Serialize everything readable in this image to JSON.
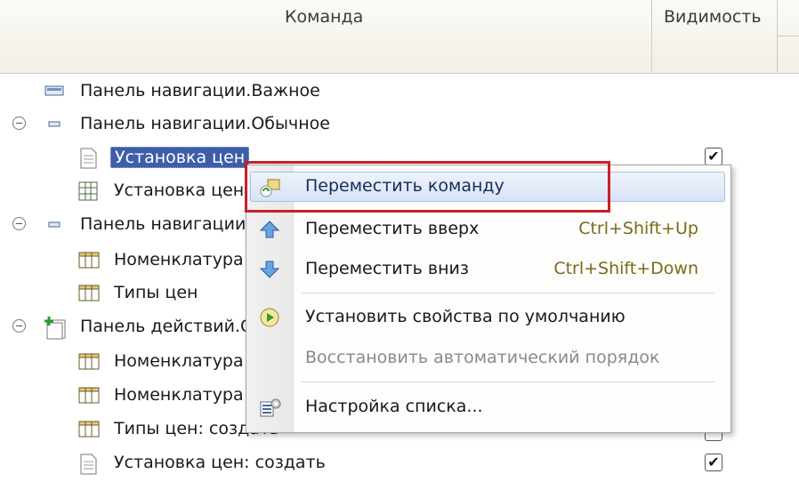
{
  "header": {
    "command_col": "Команда",
    "visibility_col": "Видимость"
  },
  "rows": [
    {
      "label": "Панель навигации.Важное",
      "icon": "panel-icon"
    },
    {
      "label": "Панель навигации.Обычное",
      "icon": "panel-small-icon"
    },
    {
      "label": "Установка цен",
      "icon": "document-icon",
      "checked": "✔"
    },
    {
      "label": "Установка цен",
      "icon": "table-grid-icon"
    },
    {
      "label": "Панель навигации",
      "icon": "panel-small-icon"
    },
    {
      "label": "Номенклатура",
      "icon": "table-icon"
    },
    {
      "label": "Типы цен",
      "icon": "table-icon"
    },
    {
      "label": "Панель действий.С",
      "icon": "action-panel-icon"
    },
    {
      "label": "Номенклатура",
      "icon": "table-icon"
    },
    {
      "label": "Номенклатура",
      "icon": "table-icon"
    },
    {
      "label": "Типы цен: создать",
      "icon": "table-icon"
    },
    {
      "label": "Установка цен: создать",
      "icon": "document-icon",
      "checked": "✔"
    }
  ],
  "context_menu": {
    "items": [
      {
        "label": "Переместить команду",
        "icon": "move-command-icon"
      },
      {
        "label": "Переместить вверх",
        "shortcut": "Ctrl+Shift+Up",
        "icon": "arrow-up-icon"
      },
      {
        "label": "Переместить вниз",
        "shortcut": "Ctrl+Shift+Down",
        "icon": "arrow-down-icon"
      },
      {
        "label": "Установить свойства по умолчанию",
        "icon": "default-properties-icon"
      },
      {
        "label": "Восстановить автоматический порядок"
      },
      {
        "label": "Настройка списка...",
        "icon": "list-settings-icon"
      }
    ]
  },
  "colors": {
    "selection": "#3d5ea8",
    "highlight_border": "#c8202a",
    "shortcut": "#7a6a1a"
  }
}
